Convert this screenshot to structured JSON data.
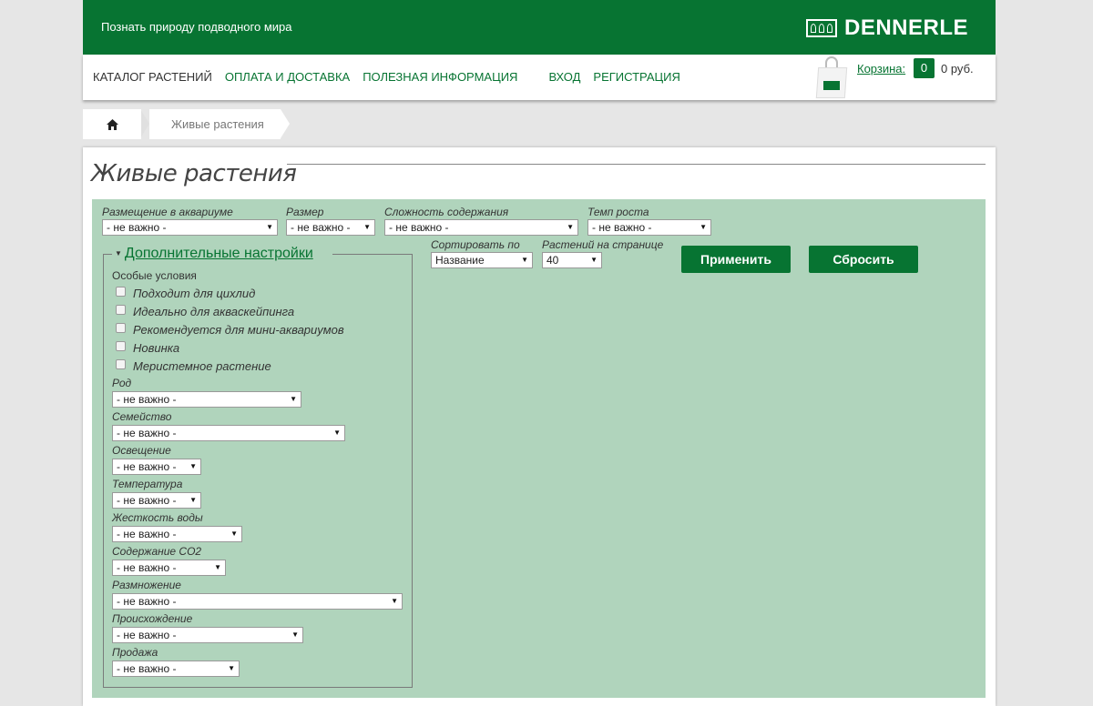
{
  "header": {
    "slogan": "Познать природу подводного мира",
    "logo": "DENNERLE"
  },
  "nav": {
    "items": [
      {
        "label": "КАТАЛОГ РАСТЕНИЙ"
      },
      {
        "label": "ОПЛАТА И ДОСТАВКА"
      },
      {
        "label": "ПОЛЕЗНАЯ ИНФОРМАЦИЯ"
      },
      {
        "label": "ВХОД"
      },
      {
        "label": "РЕГИСТРАЦИЯ"
      }
    ]
  },
  "cart": {
    "label": "Корзина:",
    "count": "0",
    "sum": "0 руб."
  },
  "breadcrumb": {
    "current": "Живые растения",
    "home_icon": "home-icon"
  },
  "page": {
    "title": "Живые растения"
  },
  "filters": {
    "placement": {
      "label": "Размещение в аквариуме",
      "value": "- не важно -"
    },
    "size": {
      "label": "Размер",
      "value": "- не важно -"
    },
    "difficulty": {
      "label": "Сложность содержания",
      "value": "- не важно -"
    },
    "growth": {
      "label": "Темп роста",
      "value": "- не важно -"
    },
    "sort": {
      "label": "Сортировать по",
      "value": "Название"
    },
    "per_page": {
      "label": "Растений на странице",
      "value": "40"
    },
    "apply_label": "Применить",
    "reset_label": "Сбросить"
  },
  "advanced": {
    "legend": "Дополнительные настройки",
    "special_title": "Особые условия",
    "checkboxes": [
      "Подходит для цихлид",
      "Идеально для акваскейпинга",
      "Рекомендуется для мини-аквариумов",
      "Новинка",
      "Меристемное растение"
    ],
    "selects": [
      {
        "label": "Род",
        "value": "- не важно -"
      },
      {
        "label": "Семейство",
        "value": "- не важно -"
      },
      {
        "label": "Освещение",
        "value": "- не важно -"
      },
      {
        "label": "Температура",
        "value": "- не важно -"
      },
      {
        "label": "Жесткость воды",
        "value": "- не важно -"
      },
      {
        "label": "Содержание CO2",
        "value": "- не важно -"
      },
      {
        "label": "Размножение",
        "value": "- не важно -"
      },
      {
        "label": "Происхождение",
        "value": "- не важно -"
      },
      {
        "label": "Продажа",
        "value": "- не важно -"
      }
    ]
  },
  "colors": {
    "brand": "#077432",
    "filter_bg": "#b0d4bc"
  }
}
